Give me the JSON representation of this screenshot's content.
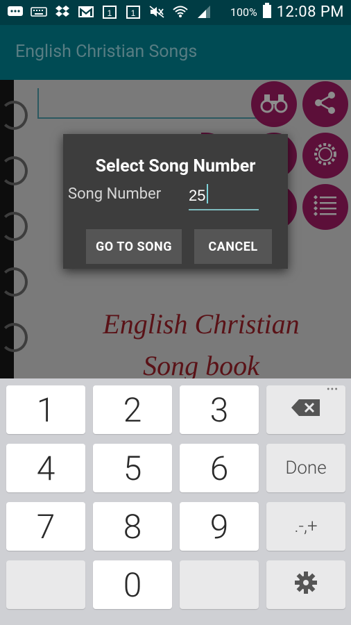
{
  "status_bar": {
    "battery": "100%",
    "time": "12:08 PM",
    "icons": [
      "chat-icon",
      "keyboard-icon",
      "dropbox-icon",
      "gmail-icon",
      "calendar-1-icon",
      "calendar-1-icon",
      "mute-icon",
      "wifi-icon",
      "signal-icon",
      "battery-icon"
    ],
    "calendar_day": "1"
  },
  "app_bar": {
    "title": "English Christian Songs"
  },
  "background": {
    "book_title_line1": "English Christian",
    "book_title_line2": "Song book",
    "round_buttons": [
      "binoculars-icon",
      "share-icon",
      "settings-icon",
      "favorites-list-icon"
    ]
  },
  "dialog": {
    "title": "Select Song Number",
    "field_label": "Song Number",
    "field_value": "25",
    "go_button": "GO TO SONG",
    "cancel_button": "CANCEL"
  },
  "keyboard": {
    "keys": [
      "1",
      "2",
      "3",
      "4",
      "5",
      "6",
      "7",
      "8",
      "9",
      "0"
    ],
    "done": "Done",
    "symbols": ".-,+",
    "more": "•••"
  },
  "colors": {
    "accent": "#7fbcbf",
    "magenta": "#9d0b5c",
    "appbar": "#00695c"
  }
}
